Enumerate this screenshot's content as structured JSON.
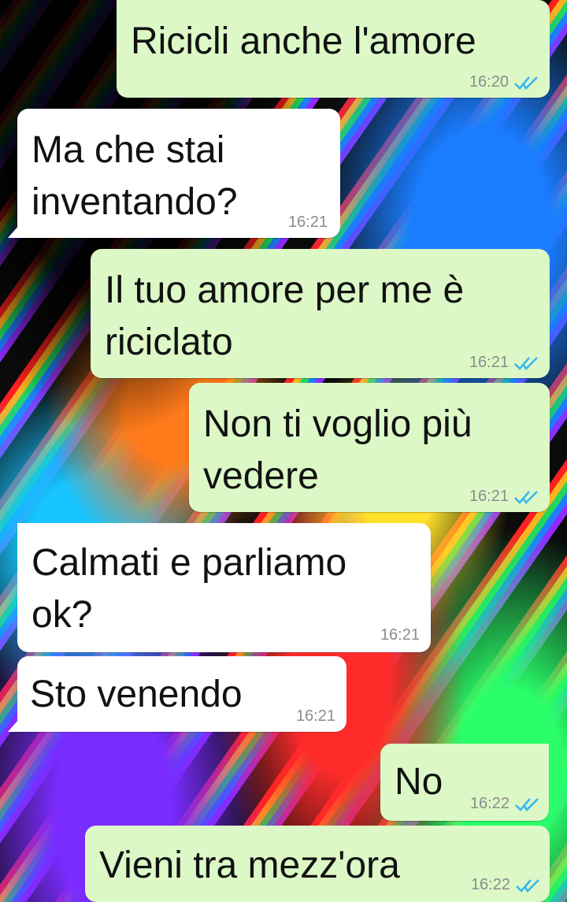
{
  "messages": [
    {
      "text": "Ricicli anche l'amore",
      "time": "16:20",
      "direction": "outgoing",
      "status": "read"
    },
    {
      "text": "Ma che stai\ninventando?",
      "time": "16:21",
      "direction": "incoming"
    },
    {
      "text": "Il tuo amore per me è\nriciclato",
      "time": "16:21",
      "direction": "outgoing",
      "status": "read"
    },
    {
      "text": "Non ti voglio più\nvedere",
      "time": "16:21",
      "direction": "outgoing",
      "status": "read"
    },
    {
      "text": "Calmati e parliamo\nok?",
      "time": "16:21",
      "direction": "incoming"
    },
    {
      "text": "Sto venendo",
      "time": "16:21",
      "direction": "incoming"
    },
    {
      "text": "No",
      "time": "16:22",
      "direction": "outgoing",
      "status": "read"
    },
    {
      "text": "Vieni tra mezz'ora",
      "time": "16:22",
      "direction": "outgoing",
      "status": "read"
    }
  ],
  "colors": {
    "outgoing_bubble": "#dcf8c6",
    "incoming_bubble": "#ffffff",
    "read_ticks": "#34b7f1",
    "timestamp": "#8c8c8c"
  },
  "icons": {
    "read_status": "double-check-icon"
  }
}
